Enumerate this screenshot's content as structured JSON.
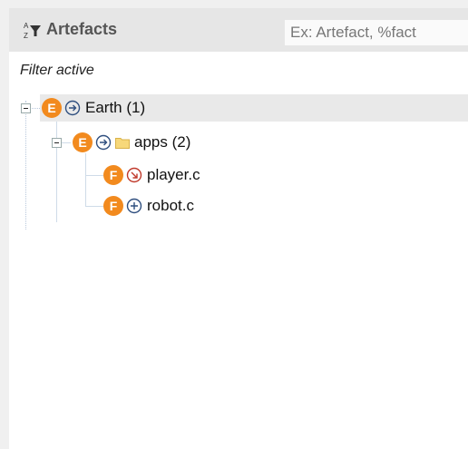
{
  "header": {
    "title": "Artefacts",
    "search_placeholder": "Ex: Artefact, %fact"
  },
  "filter_status": "Filter active",
  "tree": {
    "root": {
      "badge": "E",
      "action_icon": "arrow-right-circle-icon",
      "label": "Earth (1)",
      "expanded": true,
      "children": [
        {
          "badge": "E",
          "action_icon": "arrow-right-circle-icon",
          "folder_icon": "folder-icon",
          "label": "apps (2)",
          "expanded": true,
          "children": [
            {
              "badge": "F",
              "action_icon": "arrow-down-right-circle-icon",
              "label": "player.c",
              "icon_color": "#c0392b"
            },
            {
              "badge": "F",
              "action_icon": "plus-circle-icon",
              "label": "robot.c",
              "icon_color": "#2f4f7f"
            }
          ]
        }
      ]
    }
  },
  "colors": {
    "badge": "#f28a1e",
    "header_bg": "#e6e6e6",
    "selected_row": "#e9e9e9"
  }
}
